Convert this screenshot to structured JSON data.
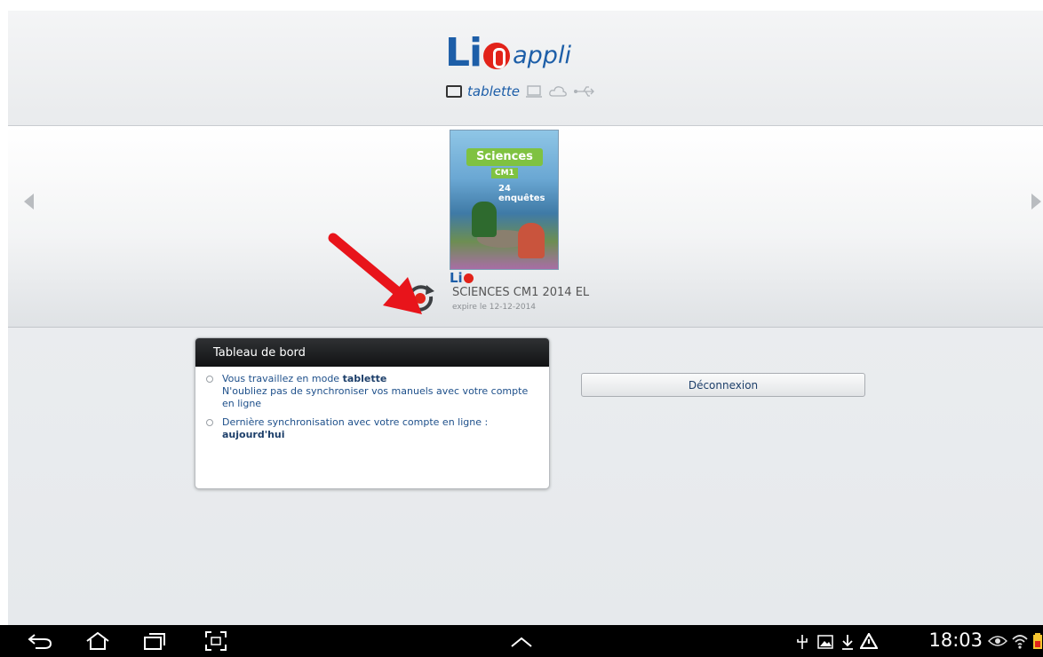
{
  "header": {
    "logo_li": "Li",
    "logo_appli": "appli",
    "mode_label": "tablette",
    "mode_icons": [
      "tablet-icon",
      "laptop-icon",
      "cloud-icon",
      "usb-icon"
    ]
  },
  "book": {
    "cover_title": "Sciences",
    "cover_level": "CM1",
    "cover_subtitle": "24 enquêtes",
    "brand": "Li",
    "title": "SCIENCES CM1 2014 EL",
    "expiry": "expire le 12-12-2014"
  },
  "dashboard": {
    "title": "Tableau de bord",
    "item1_prefix": "Vous travaillez en mode ",
    "item1_mode": "tablette",
    "item1_line2": "N'oubliez pas de synchroniser vos manuels avec votre compte en ligne",
    "item2_text": "Dernière synchronisation avec votre compte en ligne :",
    "item2_value": "aujourd'hui"
  },
  "actions": {
    "logout_label": "Déconnexion"
  },
  "statusbar": {
    "time": "18:03"
  },
  "colors": {
    "brand_blue": "#1d5ea8",
    "brand_red": "#e2231a",
    "arrow_red": "#e8141b"
  }
}
